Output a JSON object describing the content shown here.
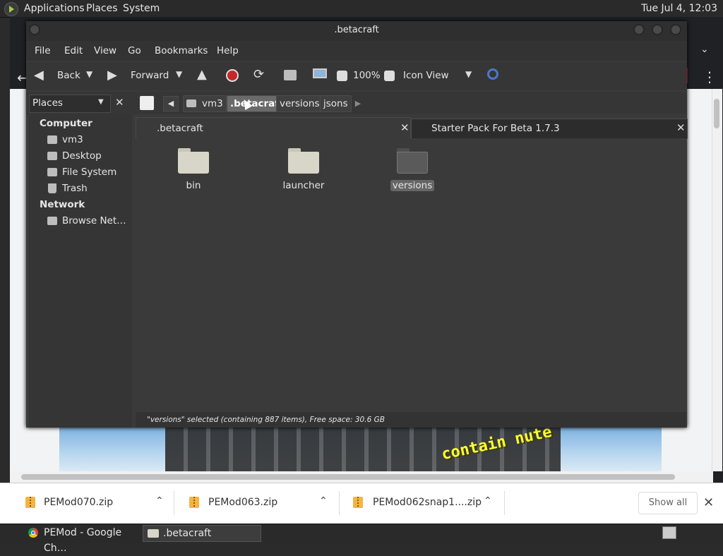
{
  "top_panel": {
    "menus": [
      "Applications",
      "Places",
      "System"
    ],
    "clock": "Tue Jul  4, 12:03"
  },
  "browser": {
    "splash_text": "contain nute",
    "downloads": [
      {
        "name": "PEMod070.zip"
      },
      {
        "name": "PEMod063.zip"
      },
      {
        "name": "PEMod062snap1....zip"
      }
    ],
    "show_all": "Show all"
  },
  "window": {
    "title": ".betacraft",
    "menus": [
      "File",
      "Edit",
      "View",
      "Go",
      "Bookmarks",
      "Help"
    ],
    "toolbar": {
      "back": "Back",
      "forward": "Forward",
      "zoom": "100%",
      "view_mode": "Icon View"
    },
    "side_pane_mode": "Places",
    "breadcrumbs": [
      "vm3",
      ".betacraft",
      "versions",
      "jsons"
    ],
    "sidebar": {
      "computer_header": "Computer",
      "computer_items": [
        "vm3",
        "Desktop",
        "File System",
        "Trash"
      ],
      "network_header": "Network",
      "network_items": [
        "Browse Net…"
      ]
    },
    "tabs": [
      ".betacraft",
      "Starter Pack For Beta 1.7.3"
    ],
    "files": [
      "bin",
      "launcher",
      "versions"
    ],
    "selected_file": "versions",
    "status": "\"versions\" selected (containing 887 items), Free space: 30.6 GB"
  },
  "taskbar": {
    "tasks": [
      "PEMod - Google Ch…",
      ".betacraft"
    ]
  },
  "colors": {
    "download_icon": "#f3b541",
    "folder": "#d8d6c8",
    "selected_folder": "#5a5a5a",
    "stop_button": "#c62828"
  }
}
